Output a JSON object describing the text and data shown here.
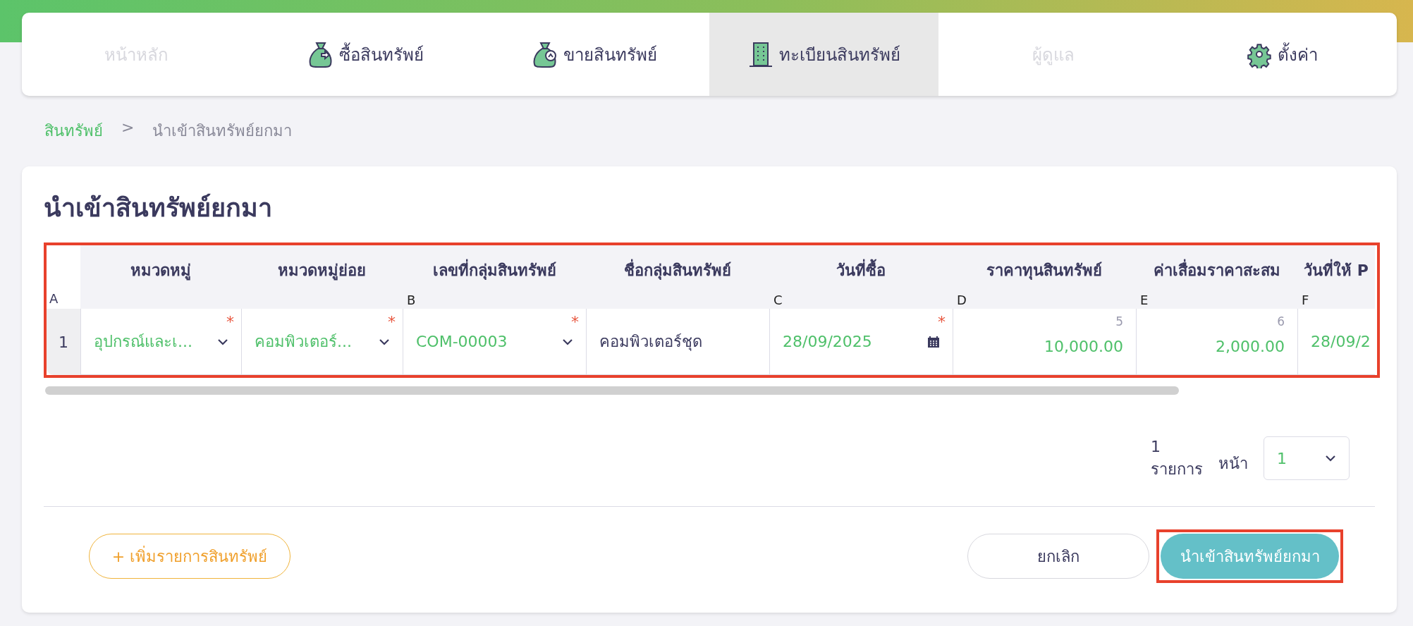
{
  "nav": {
    "tabs": [
      {
        "label": "หน้าหลัก",
        "disabled": true,
        "selected": false
      },
      {
        "label": "ซื้อสินทรัพย์",
        "disabled": false,
        "selected": false
      },
      {
        "label": "ขายสินทรัพย์",
        "disabled": false,
        "selected": false
      },
      {
        "label": "ทะเบียนสินทรัพย์",
        "disabled": false,
        "selected": true
      },
      {
        "label": "ผู้ดูแล",
        "disabled": true,
        "selected": false
      },
      {
        "label": "ตั้งค่า",
        "disabled": false,
        "selected": false
      }
    ]
  },
  "breadcrumb": [
    {
      "label": "สินทรัพย์",
      "link": true
    },
    {
      "label": ">",
      "link": false
    },
    {
      "label": "นำเข้าสินทรัพย์ยกมา",
      "link": false
    }
  ],
  "title": "นำเข้าสินทรัพย์ยกมา",
  "table": {
    "highlighted": true,
    "corner_letter": "A",
    "columns": [
      {
        "label": "หมวดหมู่"
      },
      {
        "label": "หมวดหมู่ย่อย"
      },
      {
        "label": "เลขที่กลุ่มสินทรัพย์",
        "letter": "B"
      },
      {
        "label": "ชื่อกลุ่มสินทรัพย์"
      },
      {
        "label": "วันที่ซื้อ",
        "letter": "C"
      },
      {
        "label": "ราคาทุนสินทรัพย์",
        "letter": "D"
      },
      {
        "label": "ค่าเสื่อมราคาสะสม",
        "letter": "E"
      },
      {
        "label": "วันที่ให้ P",
        "letter": "F"
      }
    ],
    "rows": [
      {
        "number": "1",
        "cells": [
          {
            "kind": "select",
            "value": "อุปกรณ์และเ...",
            "required_mark": "*"
          },
          {
            "kind": "select",
            "value": "คอมพิวเตอร์...",
            "required_mark": "*"
          },
          {
            "kind": "select",
            "value": "COM-00003",
            "required_mark": "*"
          },
          {
            "kind": "text",
            "value": "คอมพิวเตอร์ชุด"
          },
          {
            "kind": "date",
            "value": "28/09/2025",
            "required_mark": "*"
          },
          {
            "kind": "number",
            "value": "10,000.00",
            "hint": "5"
          },
          {
            "kind": "number",
            "value": "2,000.00",
            "hint": "6"
          },
          {
            "kind": "plain-green",
            "value": "28/09/2"
          }
        ]
      }
    ]
  },
  "pagination": {
    "count": "1",
    "count_label": "รายการ",
    "page_label": "หน้า",
    "page": "1"
  },
  "actions": {
    "add": "+ เพิ่มรายการสินทรัพย์",
    "cancel": "ยกเลิก",
    "submit": "นำเข้าสินทรัพย์ยกมา",
    "submit_highlighted": true
  }
}
